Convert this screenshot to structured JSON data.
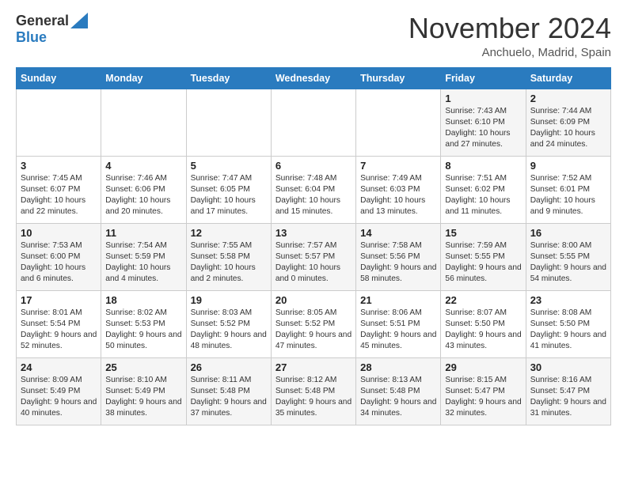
{
  "header": {
    "logo_general": "General",
    "logo_blue": "Blue",
    "month_title": "November 2024",
    "location": "Anchuelo, Madrid, Spain"
  },
  "weekdays": [
    "Sunday",
    "Monday",
    "Tuesday",
    "Wednesday",
    "Thursday",
    "Friday",
    "Saturday"
  ],
  "weeks": [
    [
      {
        "day": "",
        "info": ""
      },
      {
        "day": "",
        "info": ""
      },
      {
        "day": "",
        "info": ""
      },
      {
        "day": "",
        "info": ""
      },
      {
        "day": "",
        "info": ""
      },
      {
        "day": "1",
        "info": "Sunrise: 7:43 AM\nSunset: 6:10 PM\nDaylight: 10 hours and 27 minutes."
      },
      {
        "day": "2",
        "info": "Sunrise: 7:44 AM\nSunset: 6:09 PM\nDaylight: 10 hours and 24 minutes."
      }
    ],
    [
      {
        "day": "3",
        "info": "Sunrise: 7:45 AM\nSunset: 6:07 PM\nDaylight: 10 hours and 22 minutes."
      },
      {
        "day": "4",
        "info": "Sunrise: 7:46 AM\nSunset: 6:06 PM\nDaylight: 10 hours and 20 minutes."
      },
      {
        "day": "5",
        "info": "Sunrise: 7:47 AM\nSunset: 6:05 PM\nDaylight: 10 hours and 17 minutes."
      },
      {
        "day": "6",
        "info": "Sunrise: 7:48 AM\nSunset: 6:04 PM\nDaylight: 10 hours and 15 minutes."
      },
      {
        "day": "7",
        "info": "Sunrise: 7:49 AM\nSunset: 6:03 PM\nDaylight: 10 hours and 13 minutes."
      },
      {
        "day": "8",
        "info": "Sunrise: 7:51 AM\nSunset: 6:02 PM\nDaylight: 10 hours and 11 minutes."
      },
      {
        "day": "9",
        "info": "Sunrise: 7:52 AM\nSunset: 6:01 PM\nDaylight: 10 hours and 9 minutes."
      }
    ],
    [
      {
        "day": "10",
        "info": "Sunrise: 7:53 AM\nSunset: 6:00 PM\nDaylight: 10 hours and 6 minutes."
      },
      {
        "day": "11",
        "info": "Sunrise: 7:54 AM\nSunset: 5:59 PM\nDaylight: 10 hours and 4 minutes."
      },
      {
        "day": "12",
        "info": "Sunrise: 7:55 AM\nSunset: 5:58 PM\nDaylight: 10 hours and 2 minutes."
      },
      {
        "day": "13",
        "info": "Sunrise: 7:57 AM\nSunset: 5:57 PM\nDaylight: 10 hours and 0 minutes."
      },
      {
        "day": "14",
        "info": "Sunrise: 7:58 AM\nSunset: 5:56 PM\nDaylight: 9 hours and 58 minutes."
      },
      {
        "day": "15",
        "info": "Sunrise: 7:59 AM\nSunset: 5:55 PM\nDaylight: 9 hours and 56 minutes."
      },
      {
        "day": "16",
        "info": "Sunrise: 8:00 AM\nSunset: 5:55 PM\nDaylight: 9 hours and 54 minutes."
      }
    ],
    [
      {
        "day": "17",
        "info": "Sunrise: 8:01 AM\nSunset: 5:54 PM\nDaylight: 9 hours and 52 minutes."
      },
      {
        "day": "18",
        "info": "Sunrise: 8:02 AM\nSunset: 5:53 PM\nDaylight: 9 hours and 50 minutes."
      },
      {
        "day": "19",
        "info": "Sunrise: 8:03 AM\nSunset: 5:52 PM\nDaylight: 9 hours and 48 minutes."
      },
      {
        "day": "20",
        "info": "Sunrise: 8:05 AM\nSunset: 5:52 PM\nDaylight: 9 hours and 47 minutes."
      },
      {
        "day": "21",
        "info": "Sunrise: 8:06 AM\nSunset: 5:51 PM\nDaylight: 9 hours and 45 minutes."
      },
      {
        "day": "22",
        "info": "Sunrise: 8:07 AM\nSunset: 5:50 PM\nDaylight: 9 hours and 43 minutes."
      },
      {
        "day": "23",
        "info": "Sunrise: 8:08 AM\nSunset: 5:50 PM\nDaylight: 9 hours and 41 minutes."
      }
    ],
    [
      {
        "day": "24",
        "info": "Sunrise: 8:09 AM\nSunset: 5:49 PM\nDaylight: 9 hours and 40 minutes."
      },
      {
        "day": "25",
        "info": "Sunrise: 8:10 AM\nSunset: 5:49 PM\nDaylight: 9 hours and 38 minutes."
      },
      {
        "day": "26",
        "info": "Sunrise: 8:11 AM\nSunset: 5:48 PM\nDaylight: 9 hours and 37 minutes."
      },
      {
        "day": "27",
        "info": "Sunrise: 8:12 AM\nSunset: 5:48 PM\nDaylight: 9 hours and 35 minutes."
      },
      {
        "day": "28",
        "info": "Sunrise: 8:13 AM\nSunset: 5:48 PM\nDaylight: 9 hours and 34 minutes."
      },
      {
        "day": "29",
        "info": "Sunrise: 8:15 AM\nSunset: 5:47 PM\nDaylight: 9 hours and 32 minutes."
      },
      {
        "day": "30",
        "info": "Sunrise: 8:16 AM\nSunset: 5:47 PM\nDaylight: 9 hours and 31 minutes."
      }
    ]
  ]
}
